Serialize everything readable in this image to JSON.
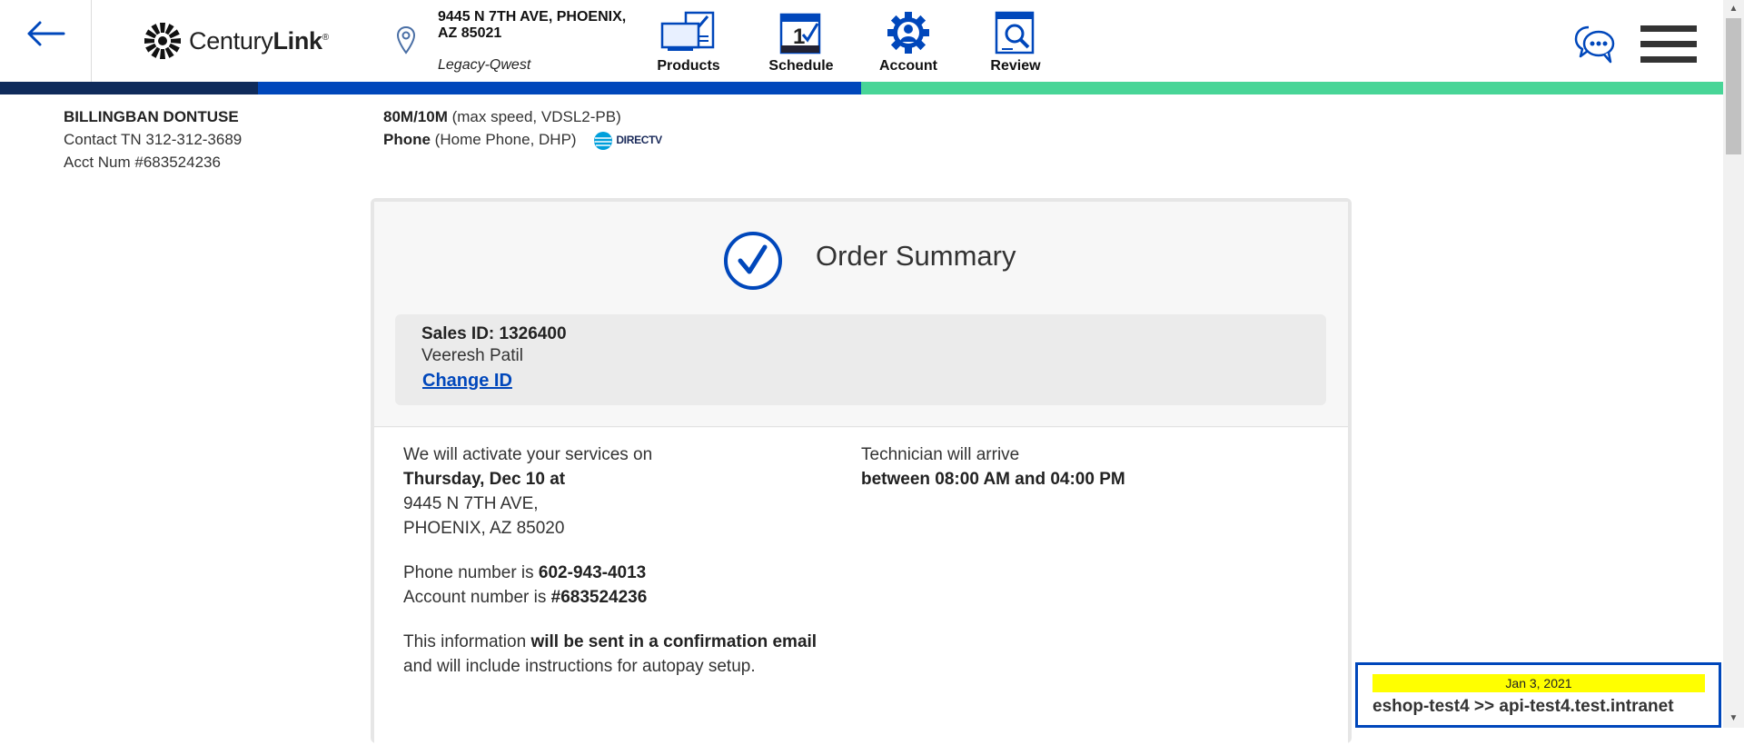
{
  "header": {
    "brand": {
      "name_regular": "Century",
      "name_bold": "Link",
      "reg_mark": "®"
    },
    "address": {
      "line1": "9445 N 7TH AVE, PHOENIX,",
      "line2": "AZ 85021",
      "sub": "Legacy-Qwest"
    },
    "nav": [
      {
        "label": "Products",
        "icon": "products-icon"
      },
      {
        "label": "Schedule",
        "icon": "schedule-icon"
      },
      {
        "label": "Account",
        "icon": "account-icon"
      },
      {
        "label": "Review",
        "icon": "review-icon"
      }
    ],
    "colors": {
      "bar_dark": "#0f2b5b",
      "bar_blue": "#0047bb",
      "bar_green": "#48d597"
    }
  },
  "customer": {
    "name": "BILLINGBAN DONTUSE",
    "contact": "Contact TN 312-312-3689",
    "acct": "Acct Num #683524236"
  },
  "services": {
    "internet_bold": "80M/10M",
    "internet_rest": " (max speed, VDSL2-PB)",
    "phone_bold": "Phone",
    "phone_rest": " (Home Phone, DHP)",
    "partner": "DIRECTV"
  },
  "order": {
    "title": "Order Summary",
    "sales_id": "Sales ID: 1326400",
    "sales_name": "Veeresh Patil",
    "change_id": "Change ID",
    "activate_intro": "We will activate your services on",
    "activate_date": "Thursday, Dec 10 at",
    "activate_addr1": "9445 N 7TH AVE,",
    "activate_addr2": "PHOENIX, AZ 85020",
    "phone_prefix": "Phone number is ",
    "phone_number": "602-943-4013",
    "account_prefix": "Account number is ",
    "account_number": "#683524236",
    "info_prefix": "This information ",
    "info_bold": "will be sent in a confirmation email",
    "info_suffix": " and will include instructions for autopay setup.",
    "tech_intro": "Technician will arrive",
    "tech_window": "between 08:00 AM and 04:00 PM"
  },
  "env": {
    "date": "Jan 3, 2021",
    "host": "eshop-test4 >> api-test4.test.intranet"
  }
}
